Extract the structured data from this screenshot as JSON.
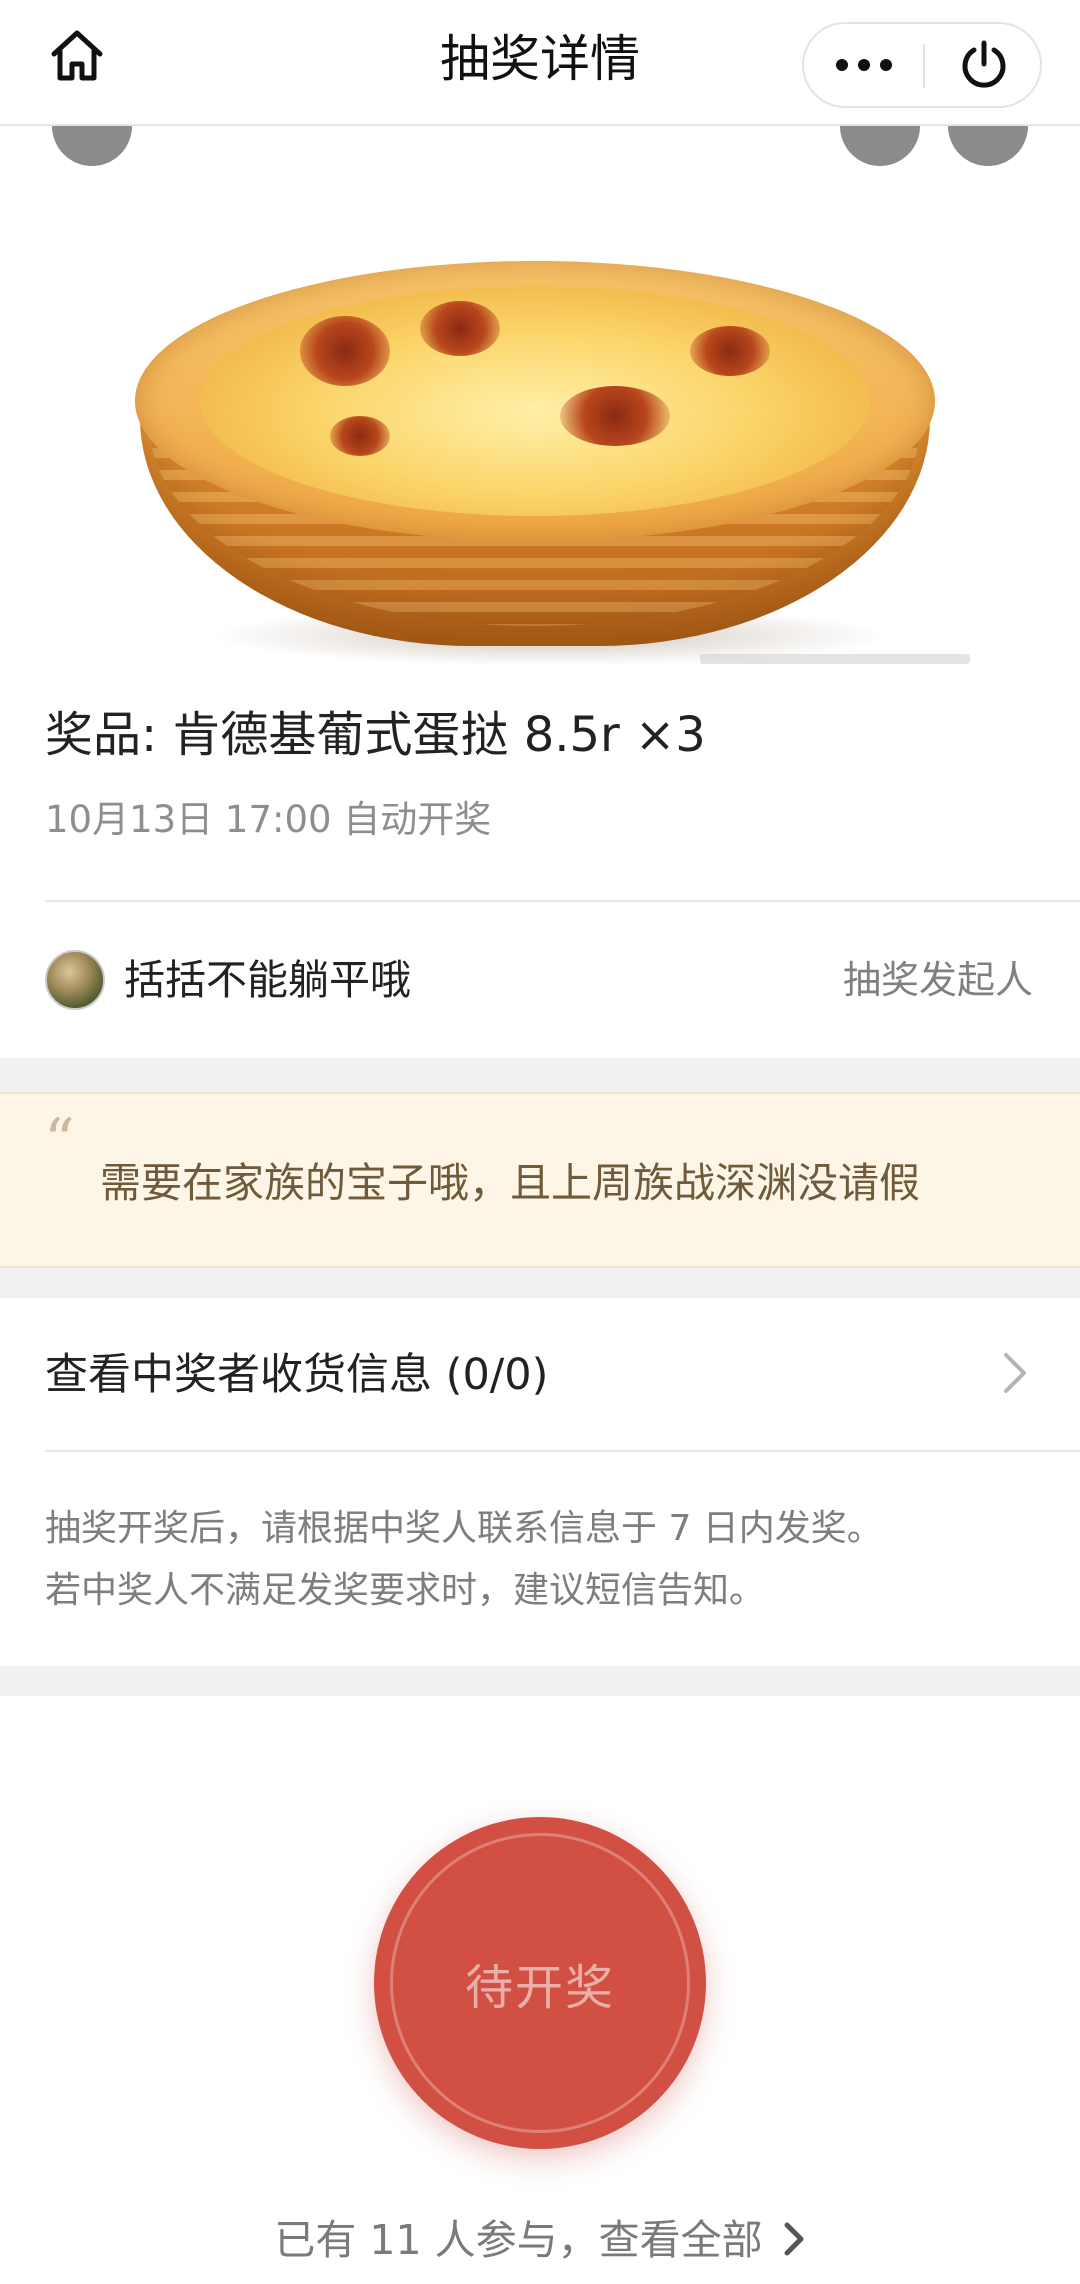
{
  "navbar": {
    "title": "抽奖详情",
    "home_icon": "home-icon",
    "more_icon": "more-dots-icon",
    "close_icon": "power-icon"
  },
  "hero": {
    "image_subject": "egg-tart-photo"
  },
  "prize": {
    "title": "奖品: 肯德基葡式蛋挞 8.5r ×3",
    "draw_time": "10月13日 17:00 自动开奖"
  },
  "organizer": {
    "name": "括括不能躺平哦",
    "role": "抽奖发起人"
  },
  "quote": {
    "mark": "“",
    "text": "需要在家族的宝子哦，且上周族战深渊没请假"
  },
  "winner_info": {
    "label": "查看中奖者收货信息 (0/0)"
  },
  "notice": {
    "line1": "抽奖开奖后，请根据中奖人联系信息于 7 日内发奖。",
    "line2": "若中奖人不满足发奖要求时，建议短信告知。"
  },
  "draw_button": {
    "label": "待开奖",
    "color": "#d24f44"
  },
  "participants": {
    "text": "已有 11 人参与，查看全部"
  },
  "colors": {
    "accent": "#d24f44",
    "quote_bg": "#fdf6e6",
    "quote_text": "#6f5a3a",
    "muted_text": "#8e8e8e",
    "section_gap": "#f1f1f1"
  }
}
